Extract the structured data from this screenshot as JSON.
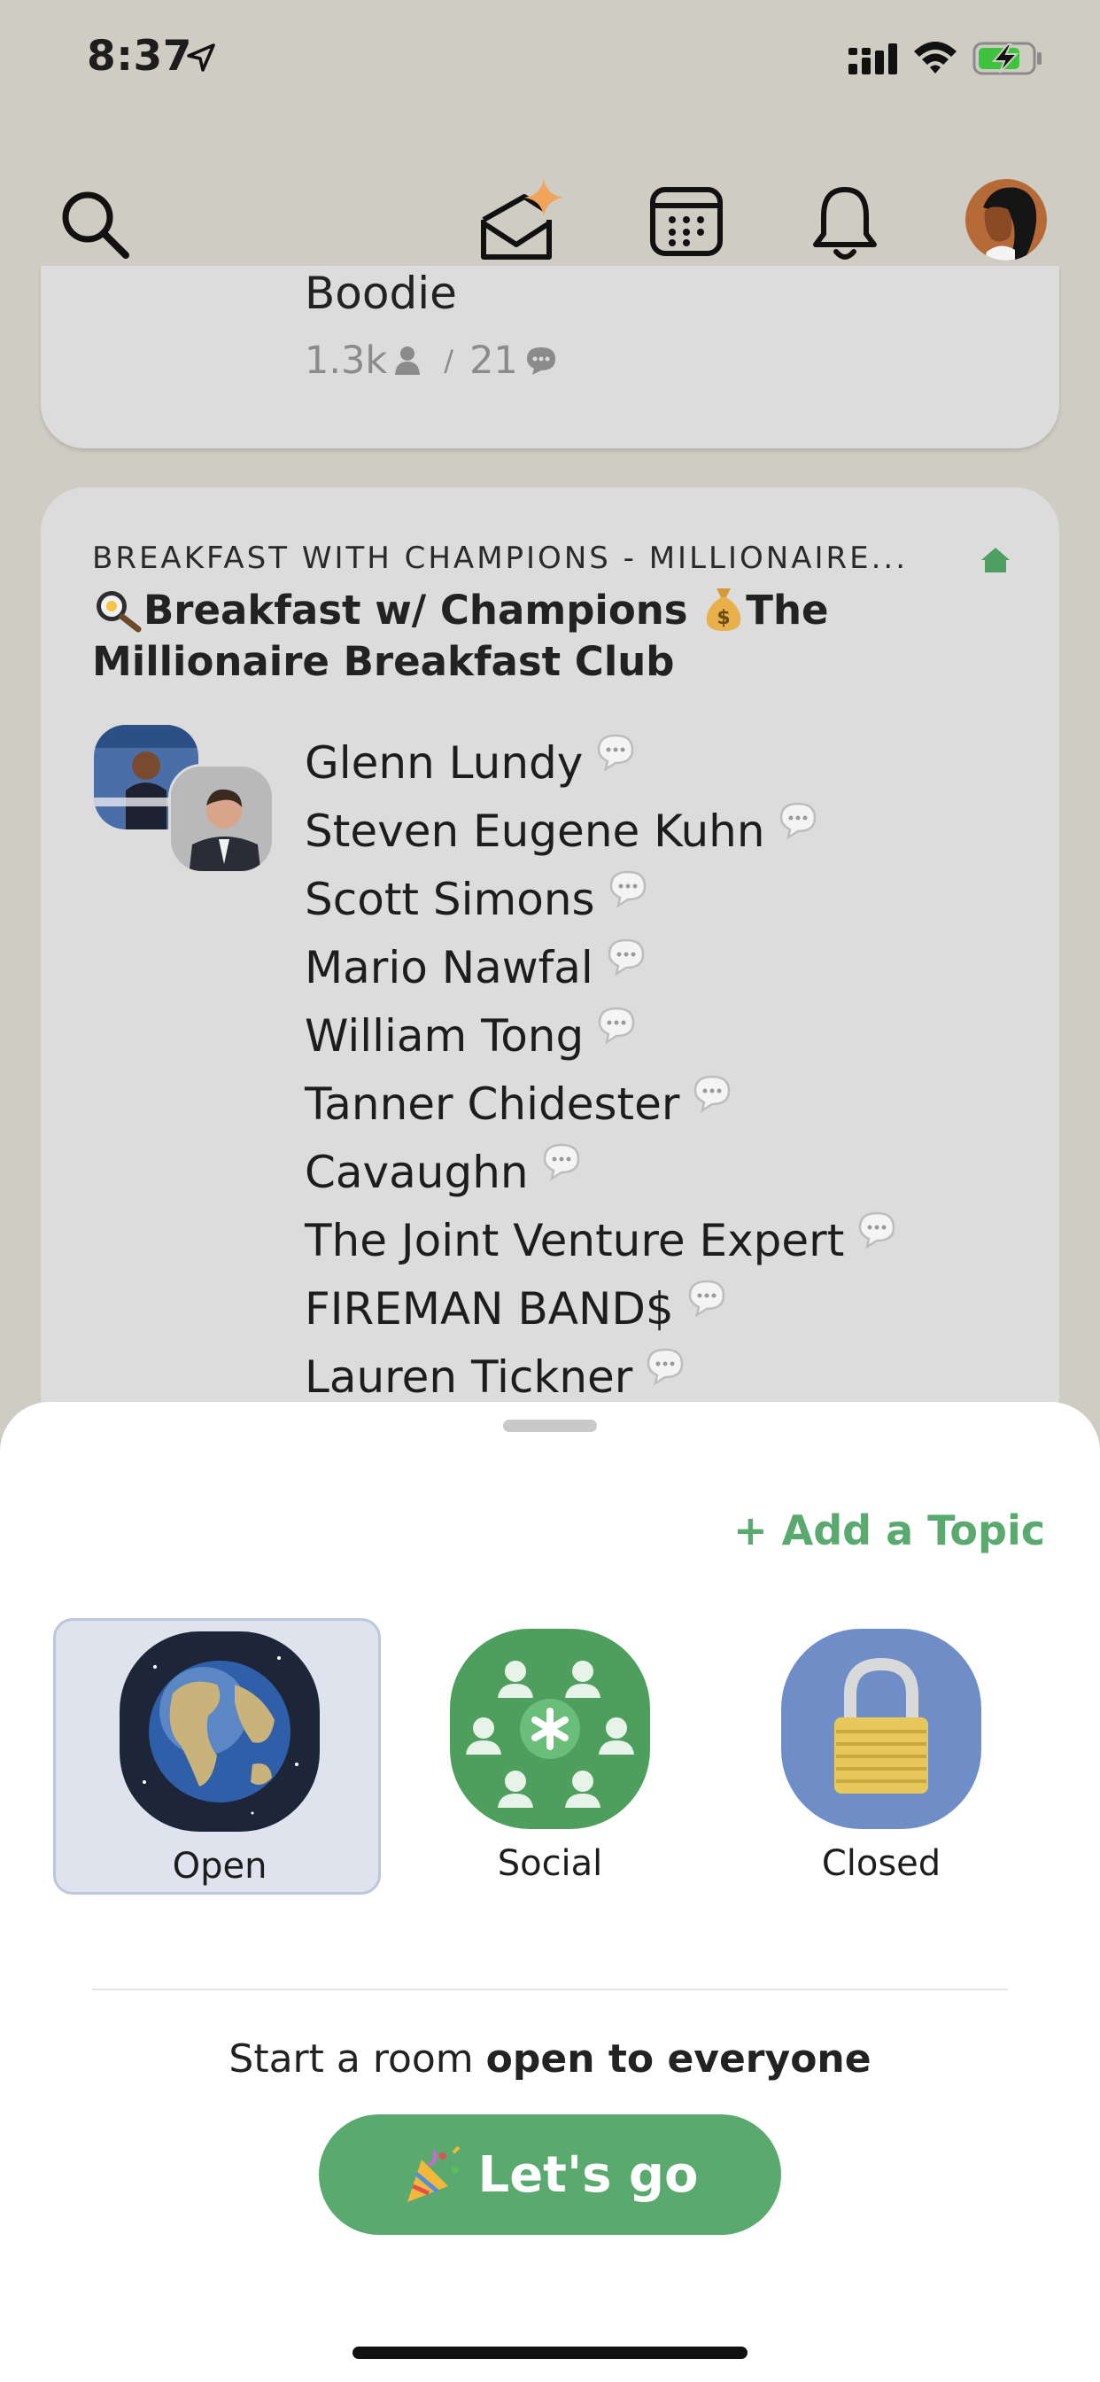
{
  "status": {
    "time": "8:37"
  },
  "previous_room": {
    "name": "Boodie",
    "listeners": "1.3k",
    "separator": "/",
    "speakers": "21"
  },
  "room": {
    "club": "BREAKFAST WITH CHAMPIONS - MILLIONAIRE...",
    "title": "Breakfast w/ Champions",
    "title_part2": "The Millionaire Breakfast Club",
    "speakers": [
      "Glenn Lundy",
      "Steven Eugene Kuhn",
      "Scott Simons",
      "Mario Nawfal",
      "William Tong",
      "Tanner Chidester",
      "Cavaughn",
      "The Joint Venture Expert",
      "FIREMAN BAND$",
      "Lauren Tickner"
    ]
  },
  "sheet": {
    "add_topic": "+ Add a Topic",
    "room_types": [
      {
        "label": "Open",
        "icon": "globe-icon",
        "selected": true
      },
      {
        "label": "Social",
        "icon": "social-group-icon",
        "selected": false
      },
      {
        "label": "Closed",
        "icon": "padlock-icon",
        "selected": false
      }
    ],
    "start_prefix": "Start a room",
    "start_emphasis": "open to everyone",
    "go_label": "Let's go"
  },
  "colors": {
    "background": "#cfccc3",
    "card": "#dcdcdc",
    "accent_green": "#5aa96f",
    "selected_tile": "#dfe3ee"
  }
}
